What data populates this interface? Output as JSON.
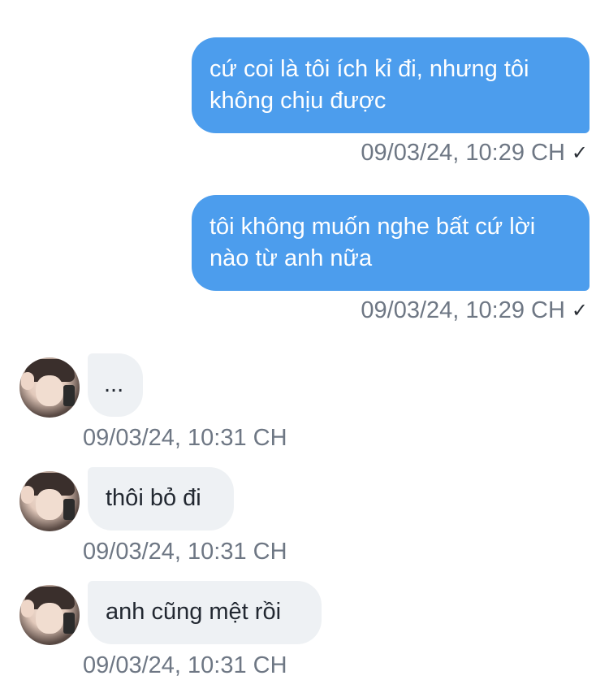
{
  "messages": [
    {
      "direction": "outgoing",
      "text": "cứ coi là tôi ích kỉ đi, nhưng tôi không chịu được",
      "timestamp": "09/03/24, 10:29 CH",
      "status_icon": "checkmark-icon"
    },
    {
      "direction": "outgoing",
      "text": "tôi không muốn nghe bất cứ lời nào từ anh nữa",
      "timestamp": "09/03/24, 10:29 CH",
      "status_icon": "checkmark-icon"
    },
    {
      "direction": "incoming",
      "text": "...",
      "timestamp": "09/03/24, 10:31 CH"
    },
    {
      "direction": "incoming",
      "text": "thôi bỏ đi",
      "timestamp": "09/03/24, 10:31 CH"
    },
    {
      "direction": "incoming",
      "text": "anh cũng mệt rồi",
      "timestamp": "09/03/24, 10:31 CH"
    }
  ],
  "check_glyph": "✓",
  "colors": {
    "outgoing_bubble": "#4c9ded",
    "incoming_bubble": "#eef1f4",
    "timestamp": "#6e7784"
  }
}
